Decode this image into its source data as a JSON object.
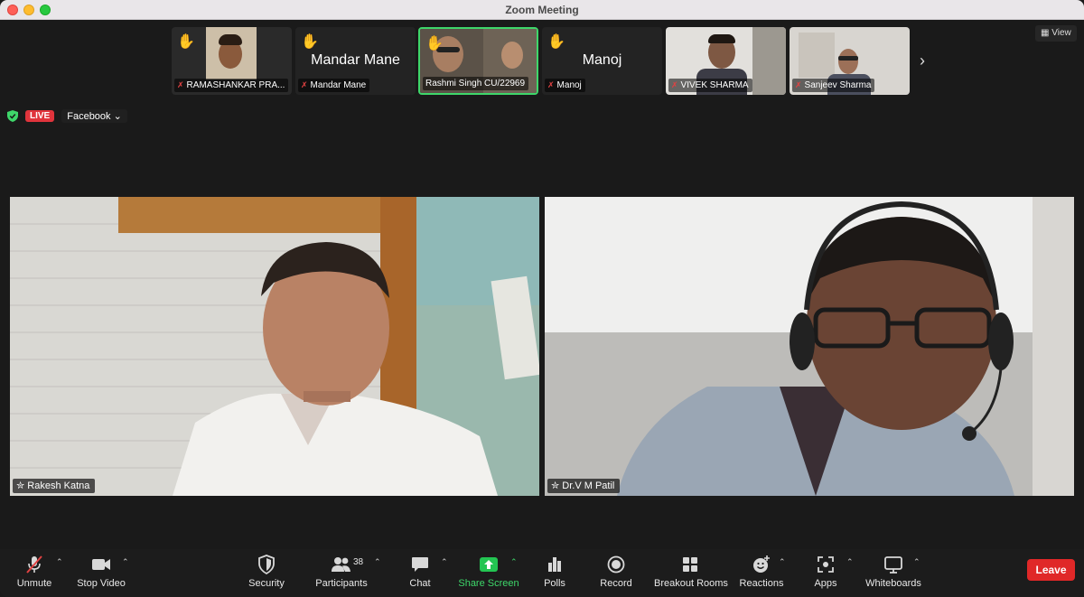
{
  "window": {
    "title": "Zoom Meeting"
  },
  "participant_strip": {
    "tiles": [
      {
        "name": "RAMASHANKAR PRA...",
        "raised_hand": true,
        "muted": true
      },
      {
        "name": "Mandar Mane",
        "display_name": "Mandar Mane",
        "raised_hand": true,
        "muted": true
      },
      {
        "name": "Rashmi Singh CU/22969",
        "raised_hand": true,
        "muted": false,
        "active": true
      },
      {
        "name": "Manoj",
        "display_name": "Manoj",
        "raised_hand": true,
        "muted": true
      },
      {
        "name": "VIVEK SHARMA",
        "raised_hand": false,
        "muted": true
      },
      {
        "name": "Sanjeev Sharma",
        "raised_hand": false,
        "muted": true
      }
    ],
    "hand_icon": "✋",
    "next_icon": "chevron-right-icon"
  },
  "view_button": {
    "label": "View",
    "icon": "grid-icon"
  },
  "stream": {
    "live_label": "LIVE",
    "platform": "Facebook"
  },
  "videos": [
    {
      "name": "Rakesh Katna"
    },
    {
      "name": "Dr.V M  Patil"
    }
  ],
  "toolbar": {
    "unmute": "Unmute",
    "stop_video": "Stop Video",
    "security": "Security",
    "participants": "Participants",
    "participants_count": "38",
    "chat": "Chat",
    "share_screen": "Share Screen",
    "polls": "Polls",
    "record": "Record",
    "breakout_rooms": "Breakout Rooms",
    "reactions": "Reactions",
    "apps": "Apps",
    "whiteboards": "Whiteboards",
    "leave": "Leave"
  },
  "colors": {
    "accent_green": "#3ed76a",
    "live_red": "#e0343c",
    "leave_red": "#e02828",
    "muted_red": "#e24242"
  }
}
